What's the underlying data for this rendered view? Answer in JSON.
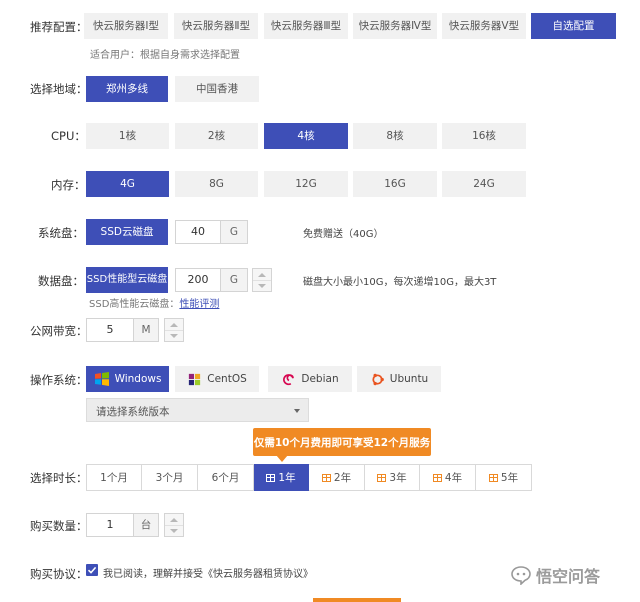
{
  "colors": {
    "accent": "#3e4fb7",
    "promo": "#f08a24"
  },
  "preset": {
    "label": "推荐配置：",
    "options": [
      "快云服务器Ⅰ型",
      "快云服务器Ⅱ型",
      "快云服务器Ⅲ型",
      "快云服务器Ⅳ型",
      "快云服务器Ⅴ型",
      "自选配置"
    ],
    "selected_index": 5,
    "hint": "适合用户：根据自身需求选择配置"
  },
  "region": {
    "label": "选择地域：",
    "options": [
      "郑州多线",
      "中国香港"
    ],
    "selected_index": 0
  },
  "cpu": {
    "label": "CPU：",
    "options": [
      "1核",
      "2核",
      "4核",
      "8核",
      "16核"
    ],
    "selected_index": 2
  },
  "memory": {
    "label": "内存：",
    "options": [
      "4G",
      "8G",
      "12G",
      "16G",
      "24G"
    ],
    "selected_index": 0
  },
  "system_disk": {
    "label": "系统盘：",
    "type": "SSD云磁盘",
    "value": "40",
    "unit": "G",
    "note": "免费赠送（40G）"
  },
  "data_disk": {
    "label": "数据盘：",
    "type": "SSD性能型云磁盘",
    "value": "200",
    "unit": "G",
    "note": "磁盘大小最小10G，每次递增10G，最大3T",
    "hint_prefix": "SSD高性能云磁盘：",
    "hint_link": "性能评测"
  },
  "bandwidth": {
    "label": "公网带宽：",
    "value": "5",
    "unit": "M"
  },
  "os": {
    "label": "操作系统：",
    "options": [
      {
        "name": "Windows",
        "icon": "windows-logo-icon"
      },
      {
        "name": "CentOS",
        "icon": "centos-logo-icon"
      },
      {
        "name": "Debian",
        "icon": "debian-logo-icon"
      },
      {
        "name": "Ubuntu",
        "icon": "ubuntu-logo-icon"
      }
    ],
    "selected_index": 0,
    "version_placeholder": "请选择系统版本"
  },
  "promo": {
    "text": "仅需10个月费用即可享受12个月服务"
  },
  "duration": {
    "label": "选择时长：",
    "options": [
      "1个月",
      "3个月",
      "6个月",
      "1年",
      "2年",
      "3年",
      "4年",
      "5年"
    ],
    "selected_index": 3
  },
  "quantity": {
    "label": "购买数量：",
    "value": "1",
    "unit": "台"
  },
  "agreement": {
    "label": "购买协议：",
    "checked": true,
    "text": "我已阅读，理解并接受《快云服务器租赁协议》"
  },
  "watermark": {
    "text": "悟空问答"
  }
}
